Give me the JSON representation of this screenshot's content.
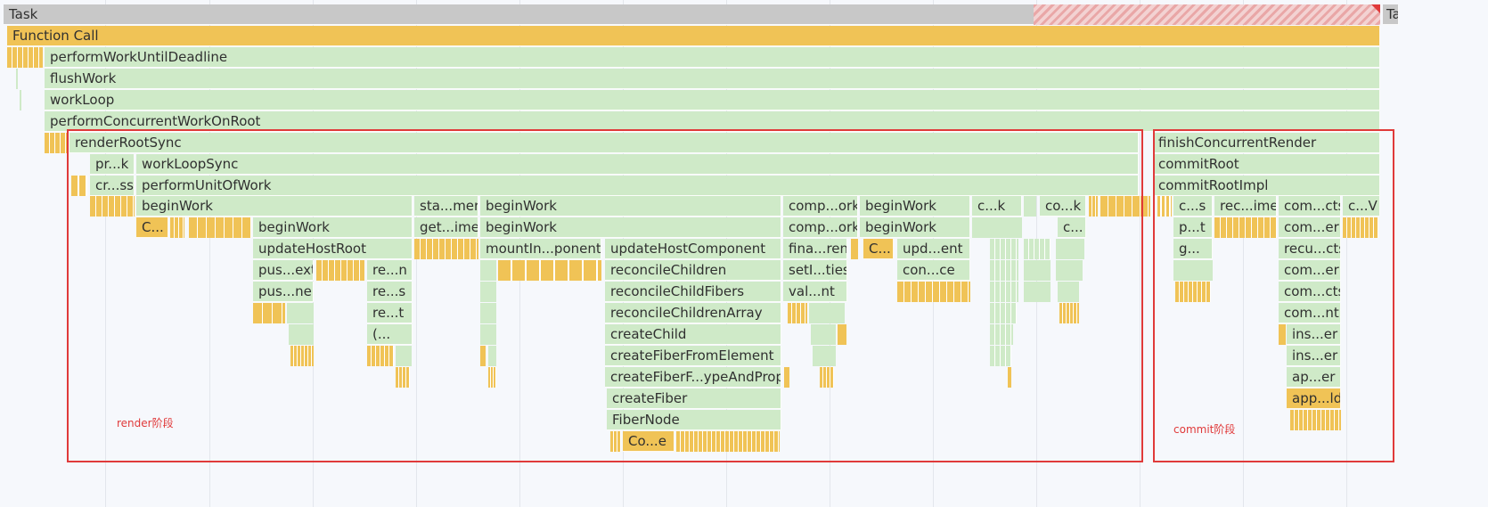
{
  "labels": {
    "task": "Task",
    "task_cut": "Ta",
    "function_call": "Function Call",
    "l3": "performWorkUntilDeadline",
    "l4": "flushWork",
    "l5": "workLoop",
    "l6": "performConcurrentWorkOnRoot",
    "render_root_sync": "renderRootSync",
    "finish_concurrent_render": "finishConcurrentRender",
    "pr_k": "pr...k",
    "work_loop_sync": "workLoopSync",
    "commit_root": "commitRoot",
    "cr_ss": "cr...ss",
    "perform_unit_of_work": "performUnitOfWork",
    "commit_root_impl": "commitRootImpl",
    "begin_work": "beginWork",
    "sta_mer": "sta...mer",
    "comp_ork": "comp...ork",
    "c_k": "c...k",
    "co_k": "co...k",
    "c_s": "c...s",
    "rec_ime": "rec...ime",
    "com_cts": "com...cts",
    "c_v": "c...V",
    "c_yellow": "C...",
    "get_ime": "get...ime",
    "c_dots": "c...",
    "p_t": "p...t",
    "com_er": "com...er",
    "update_host_root": "updateHostRoot",
    "mount_in_ponent": "mountIn...ponent",
    "update_host_component": "updateHostComponent",
    "fina_ren": "fina...ren",
    "c_yellow2": "C...",
    "upd_ent": "upd...ent",
    "g_dots": "g...",
    "recu_cts": "recu...cts",
    "pus_ext": "pus...ext",
    "re_n": "re...n",
    "reconcile_children": "reconcileChildren",
    "set_ties": "setI...ties",
    "con_ce": "con...ce",
    "com_er2": "com...er",
    "pus_ner": "pus...ner",
    "re_s": "re...s",
    "reconcile_child_fibers": "reconcileChildFibers",
    "val_nt": "val...nt",
    "com_cts2": "com...cts",
    "re_t": "re...t",
    "reconcile_children_array": "reconcileChildrenArray",
    "com_nt": "com...nt",
    "paren": "(...",
    "create_child": "createChild",
    "ins_er": "ins...er",
    "create_fiber_from_element": "createFiberFromElement",
    "ins_er2": "ins...er",
    "create_fiber_type_and_props": "createFiberF...ypeAndProps",
    "ap_er": "ap...er",
    "create_fiber": "createFiber",
    "app_ld": "app...ld",
    "fiber_node": "FiberNode",
    "co_e": "Co...e"
  },
  "annotations": {
    "render_phase": "render阶段",
    "commit_phase": "commit阶段"
  },
  "colors": {
    "green": "#cfeac8",
    "yellow": "#f0c356",
    "task": "#c8c8c8",
    "highlight": "#e03a3a"
  }
}
